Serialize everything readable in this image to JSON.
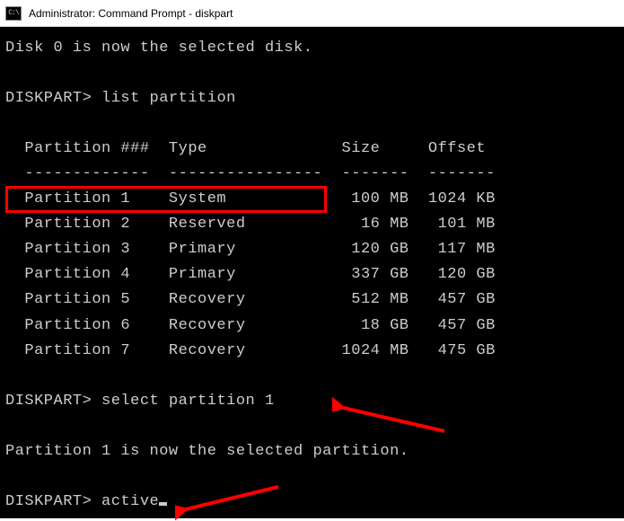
{
  "window": {
    "title": "Administrator: Command Prompt - diskpart",
    "icon_label": "cmd-icon"
  },
  "output": {
    "disk_selected_msg": "Disk 0 is now the selected disk.",
    "prompt1_label": "DISKPART>",
    "cmd1": "list partition",
    "prompt2_label": "DISKPART>",
    "cmd2": "select partition 1",
    "partition_selected_msg": "Partition 1 is now the selected partition.",
    "prompt3_label": "DISKPART>",
    "cmd3": "active"
  },
  "table": {
    "header": "  Partition ###  Type              Size     Offset",
    "separator": "  -------------  ----------------  -------  -------",
    "rows": [
      "  Partition 1    System             100 MB  1024 KB",
      "  Partition 2    Reserved            16 MB   101 MB",
      "  Partition 3    Primary            120 GB   117 MB",
      "  Partition 4    Primary            337 GB   120 GB",
      "  Partition 5    Recovery           512 MB   457 GB",
      "  Partition 6    Recovery            18 GB   457 GB",
      "  Partition 7    Recovery          1024 MB   475 GB"
    ]
  },
  "chart_data": {
    "type": "table",
    "title": "Partition list (Disk 0)",
    "columns": [
      "Partition ###",
      "Type",
      "Size",
      "Offset"
    ],
    "rows": [
      {
        "partition": "Partition 1",
        "type": "System",
        "size_value": 100,
        "size_unit": "MB",
        "offset_value": 1024,
        "offset_unit": "KB"
      },
      {
        "partition": "Partition 2",
        "type": "Reserved",
        "size_value": 16,
        "size_unit": "MB",
        "offset_value": 101,
        "offset_unit": "MB"
      },
      {
        "partition": "Partition 3",
        "type": "Primary",
        "size_value": 120,
        "size_unit": "GB",
        "offset_value": 117,
        "offset_unit": "MB"
      },
      {
        "partition": "Partition 4",
        "type": "Primary",
        "size_value": 337,
        "size_unit": "GB",
        "offset_value": 120,
        "offset_unit": "GB"
      },
      {
        "partition": "Partition 5",
        "type": "Recovery",
        "size_value": 512,
        "size_unit": "MB",
        "offset_value": 457,
        "offset_unit": "GB"
      },
      {
        "partition": "Partition 6",
        "type": "Recovery",
        "size_value": 18,
        "size_unit": "GB",
        "offset_value": 457,
        "offset_unit": "GB"
      },
      {
        "partition": "Partition 7",
        "type": "Recovery",
        "size_value": 1024,
        "size_unit": "MB",
        "offset_value": 475,
        "offset_unit": "GB"
      }
    ]
  },
  "annotations": {
    "highlight_row_index": 0,
    "arrows": 2,
    "color": "#ff0000"
  }
}
